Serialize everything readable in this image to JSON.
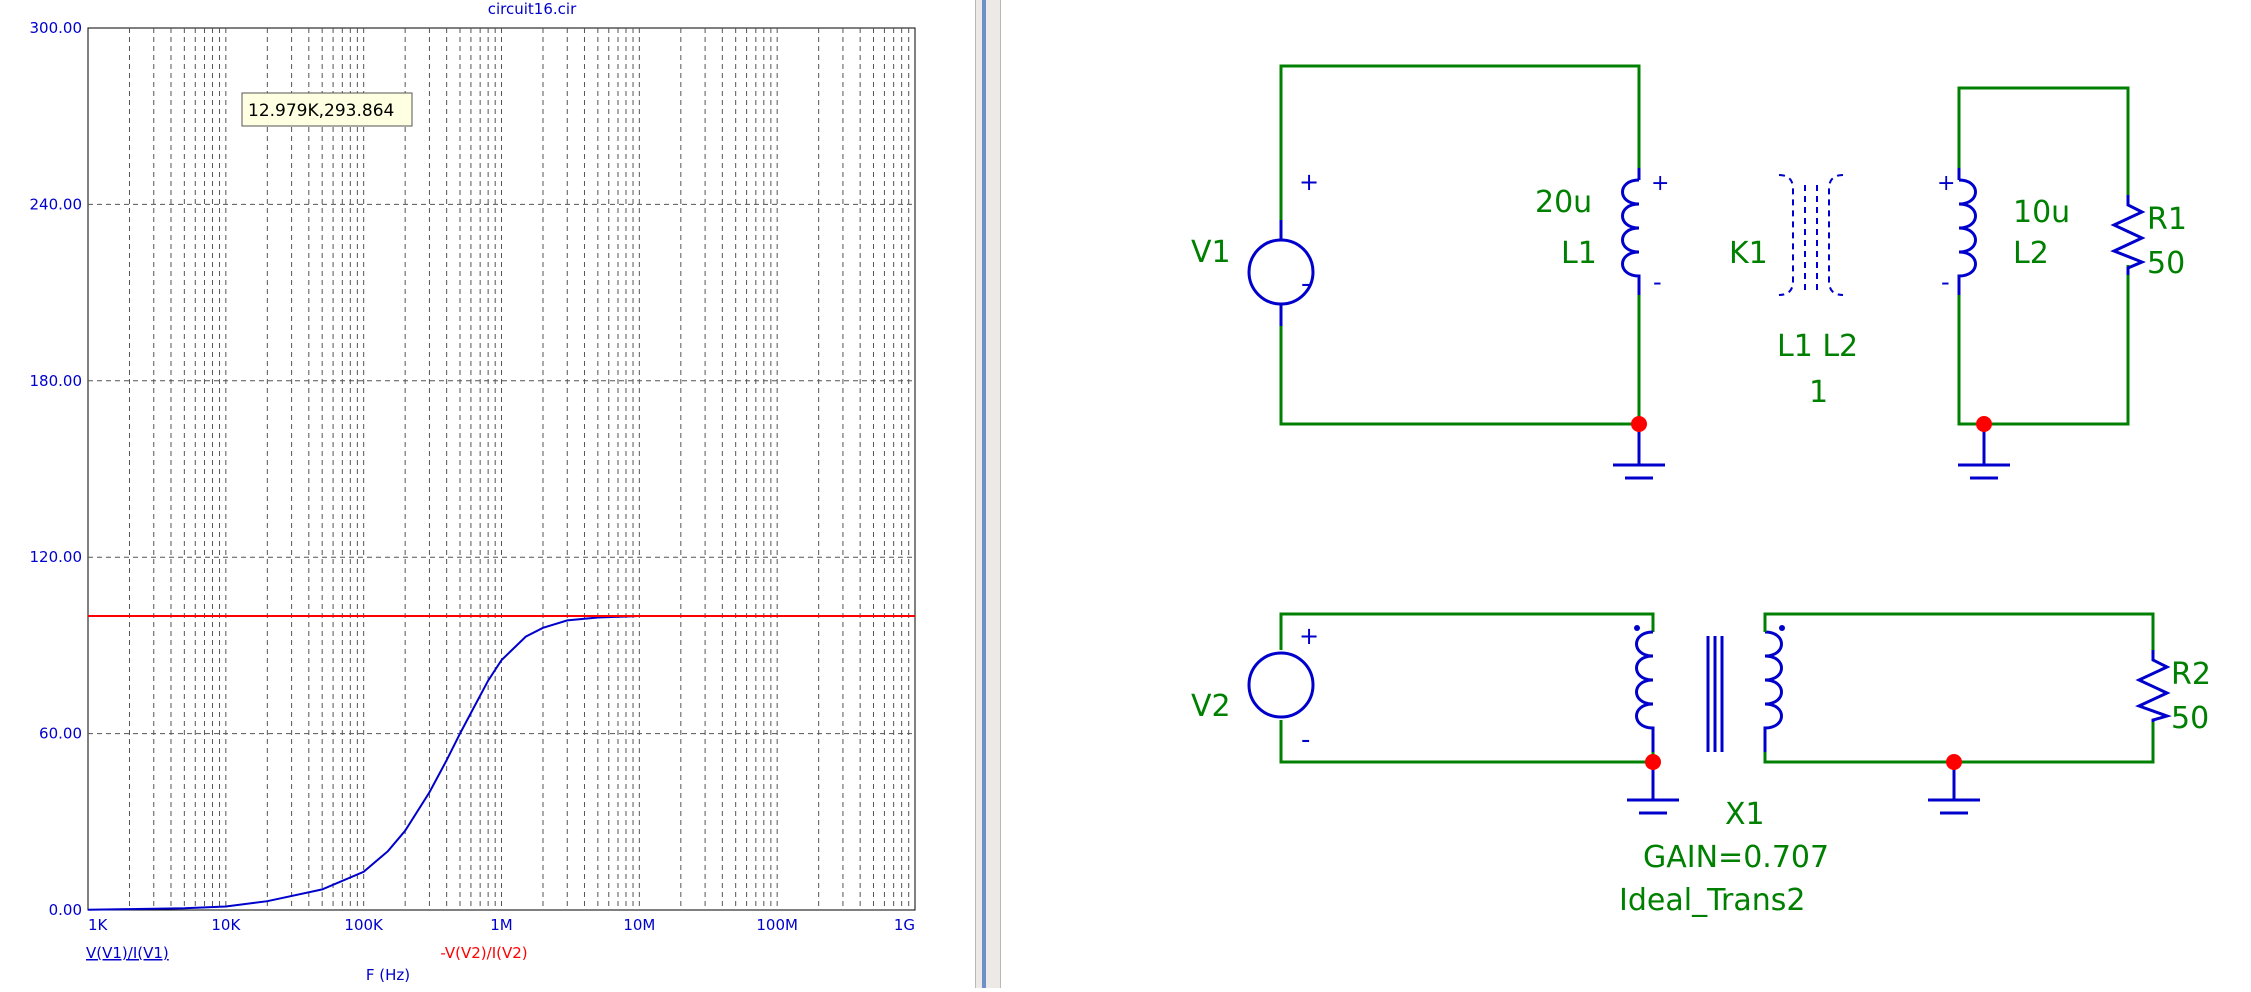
{
  "plot": {
    "title": "circuit16.cir",
    "cursor_readout": "12.979K,293.864",
    "xlabel": "F (Hz)",
    "trace_labels": [
      "V(V1)/I(V1)",
      "-V(V2)/I(V2)"
    ]
  },
  "chart_data": {
    "type": "line",
    "title": "circuit16.cir",
    "xlabel": "F (Hz)",
    "ylabel": "",
    "xscale": "log",
    "xlim": [
      1000,
      1000000000
    ],
    "ylim": [
      0,
      300
    ],
    "grid": true,
    "x_tick_labels": [
      "1K",
      "10K",
      "100K",
      "1M",
      "10M",
      "100M",
      "1G"
    ],
    "y_tick_labels": [
      "0.00",
      "60.00",
      "120.00",
      "180.00",
      "240.00",
      "300.00"
    ],
    "series": [
      {
        "name": "V(V1)/I(V1)",
        "color": "#0000cc",
        "x": [
          1000,
          2000,
          5000,
          10000,
          20000,
          50000,
          100000,
          150000,
          200000,
          300000,
          400000,
          500000,
          600000,
          800000,
          1000000,
          1500000,
          2000000,
          3000000,
          5000000,
          10000000,
          18000000
        ],
        "y": [
          0.1,
          0.3,
          0.6,
          1.2,
          3,
          7,
          13,
          20,
          27,
          40,
          51,
          60,
          67,
          78,
          85,
          93,
          96,
          98.5,
          99.5,
          100,
          100
        ]
      },
      {
        "name": "-V(V2)/I(V2)",
        "color": "#ff0000",
        "x": [
          1000,
          1000000000
        ],
        "y": [
          100,
          100
        ]
      }
    ]
  },
  "schematic": {
    "top": {
      "source": "V1",
      "l1_value": "20u",
      "l1_name": "L1",
      "coupling": "K1",
      "coupling_refs": "L1 L2",
      "coupling_value": "1",
      "l2_value": "10u",
      "l2_name": "L2",
      "resistor_name": "R1",
      "resistor_value": "50"
    },
    "bottom": {
      "source": "V2",
      "transformer_name": "X1",
      "transformer_gain": "GAIN=0.707",
      "transformer_model": "Ideal_Trans2",
      "resistor_name": "R2",
      "resistor_value": "50"
    },
    "colors": {
      "wire": "#008000",
      "component": "#0000cc",
      "node": "#ff0000",
      "label": "#008000"
    }
  }
}
